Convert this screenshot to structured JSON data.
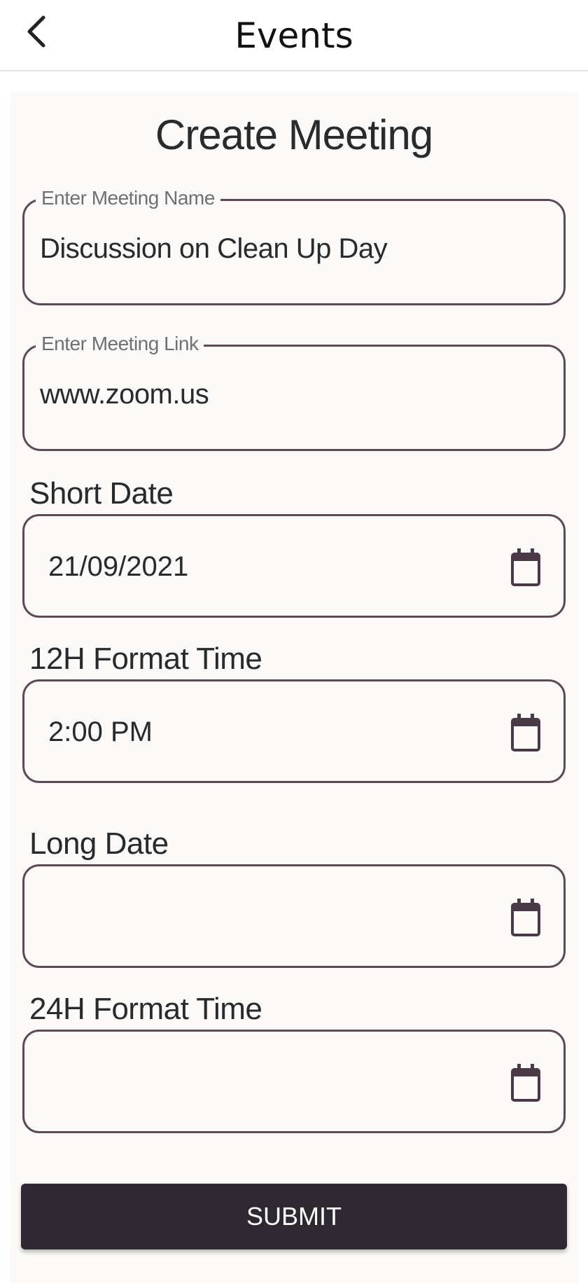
{
  "header": {
    "title": "Events",
    "back_icon": "chevron-left-icon"
  },
  "form": {
    "title": "Create Meeting",
    "meeting_name": {
      "label": "Enter Meeting Name",
      "value": "Discussion on Clean Up Day"
    },
    "meeting_link": {
      "label": "Enter Meeting Link",
      "value": "www.zoom.us"
    },
    "short_date": {
      "label": "Short Date",
      "value": "21/09/2021",
      "icon": "calendar-icon"
    },
    "time_12h": {
      "label": "12H Format Time",
      "value": "2:00 PM",
      "icon": "calendar-icon"
    },
    "long_date": {
      "label": "Long Date",
      "value": "",
      "icon": "calendar-icon"
    },
    "time_24h": {
      "label": "24H Format Time",
      "value": "",
      "icon": "calendar-icon"
    },
    "submit_label": "SUBMIT"
  },
  "colors": {
    "border": "#5d4a55",
    "button_bg": "#2e2830",
    "card_bg": "#fbfaf8"
  }
}
